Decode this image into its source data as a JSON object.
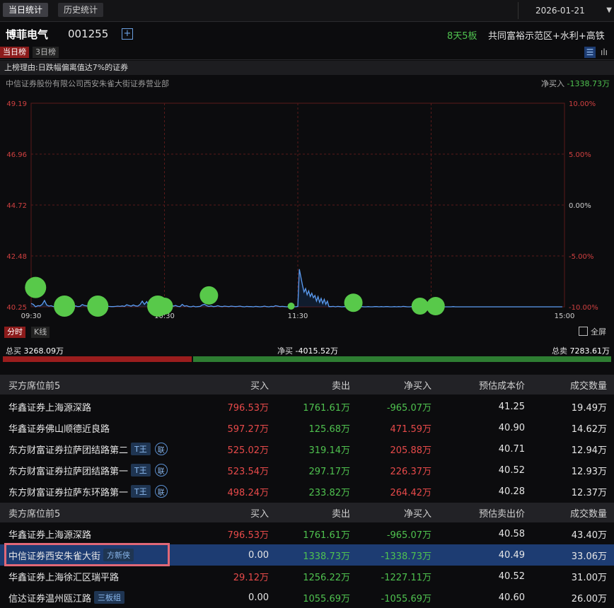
{
  "top_tabs": [
    "当日统计",
    "历史统计"
  ],
  "date": "2026-01-21",
  "stock": {
    "name": "博菲电气",
    "code": "001255",
    "add_icon": "plus-square-icon",
    "board": "8天5板",
    "concept": "共同富裕示范区+水利+高铁"
  },
  "sub_tabs": [
    "当日榜",
    "3日榜"
  ],
  "reason": "上榜理由:日跌幅偏离值达7%的证券",
  "seat": "中信证券股份有限公司西安朱雀大街证券营业部",
  "seat_netbuy_label": "净买入",
  "seat_netbuy_value": "-1338.73万",
  "chart_data": {
    "type": "line",
    "x_start": "09:30",
    "x_end": "15:00",
    "x_ticks": [
      "09:30",
      "10:30",
      "11:30",
      "15:00"
    ],
    "ylim": [
      40.25,
      49.19
    ],
    "y_left_ticks": [
      "49.19",
      "46.96",
      "44.72",
      "42.48",
      "40.25"
    ],
    "y_right_ticks": [
      "10.00%",
      "5.00%",
      "0.00%",
      "-5.00%",
      "-10.00%"
    ],
    "series": [
      {
        "values": [
          40.4,
          40.36,
          40.25,
          40.3,
          40.29,
          40.36,
          40.53,
          40.33,
          40.28,
          40.3,
          40.26,
          40.29,
          40.27,
          40.3,
          40.27,
          40.28,
          40.26,
          40.28,
          40.27,
          40.26,
          40.29,
          40.26,
          40.27,
          40.35,
          40.31,
          40.29,
          40.3,
          40.29,
          40.28,
          40.27,
          40.26,
          40.29,
          40.27,
          40.26,
          40.28,
          40.27,
          40.26,
          40.26,
          40.27,
          40.28,
          40.27,
          40.29,
          40.27,
          40.34,
          40.31,
          40.28,
          40.33,
          40.29,
          40.28,
          40.35,
          40.5,
          40.36,
          40.48,
          40.29,
          40.26,
          40.3,
          40.27,
          40.32,
          40.45,
          40.3,
          40.38,
          40.31,
          40.27,
          40.33,
          40.28,
          40.31,
          40.27,
          40.26,
          40.36,
          40.28,
          40.3,
          40.26,
          40.25,
          40.28,
          40.25,
          40.26,
          40.27,
          40.33,
          40.36,
          40.3,
          40.27,
          40.29,
          40.26,
          40.27,
          40.3,
          40.27,
          40.26,
          40.28,
          40.27,
          40.26,
          40.28,
          40.27,
          40.26,
          40.27,
          40.28,
          40.26,
          40.25,
          40.27,
          40.26,
          40.26,
          40.25,
          40.27,
          40.26,
          40.25,
          40.26,
          40.28,
          40.26,
          40.25,
          40.27,
          40.26,
          40.3,
          40.28,
          40.26,
          40.27,
          40.26,
          40.25,
          40.26,
          40.25,
          40.26,
          40.25,
          40.26,
          40.26,
          40.27,
          40.25,
          40.27,
          40.26,
          40.25,
          40.26,
          40.25,
          40.26,
          40.25,
          40.28,
          40.3,
          40.26,
          40.27,
          40.26,
          40.25,
          40.25,
          40.26,
          40.25,
          40.25,
          40.26,
          40.26,
          40.25,
          40.26,
          40.25,
          40.26,
          40.26,
          40.25,
          40.25,
          40.26,
          40.25,
          40.26,
          40.25,
          40.27,
          40.26,
          40.25,
          40.25,
          40.26,
          40.25,
          40.26,
          40.25,
          40.25,
          40.25,
          40.25,
          40.26,
          40.25,
          40.26,
          40.25,
          40.25,
          40.25,
          40.25,
          40.26,
          40.25,
          40.25,
          40.25,
          40.25,
          40.26,
          40.25,
          40.25,
          40.25,
          40.25,
          40.25,
          40.25,
          40.25,
          40.25,
          40.25,
          40.25,
          40.25,
          40.25,
          40.25,
          40.25,
          40.25,
          40.25,
          40.25,
          40.25,
          40.25,
          40.25,
          40.25,
          40.25,
          40.25,
          40.25,
          40.25,
          40.25,
          40.25,
          40.25,
          40.25,
          40.25,
          40.25,
          40.25,
          40.25,
          40.25,
          40.25,
          40.25,
          40.25,
          40.25,
          40.25,
          40.25,
          40.25,
          40.25,
          40.25,
          40.25,
          40.25,
          40.25,
          40.25,
          40.25,
          40.25,
          40.25
        ]
      }
    ],
    "spike": {
      "from": "11:30",
      "values": [
        40.27,
        41.9,
        41.55,
        41.2,
        40.9,
        41.05,
        40.78,
        40.95,
        40.7,
        40.85,
        40.65,
        40.75,
        40.5,
        40.7,
        40.45,
        40.62,
        40.4,
        40.58,
        40.36,
        40.5
      ]
    },
    "markers": [
      {
        "t": "09:32",
        "v": 41.1,
        "r": 15
      },
      {
        "t": "09:45",
        "v": 40.25,
        "r": 15
      },
      {
        "t": "10:00",
        "v": 40.25,
        "r": 15
      },
      {
        "t": "10:27",
        "v": 40.25,
        "r": 15
      },
      {
        "t": "10:30",
        "v": 40.22,
        "r": 12
      },
      {
        "t": "10:50",
        "v": 40.75,
        "r": 13
      },
      {
        "t": "11:27",
        "v": 40.23,
        "r": 5
      },
      {
        "t": "13:25",
        "v": 40.43,
        "r": 13
      },
      {
        "t": "13:55",
        "v": 40.25,
        "r": 12
      },
      {
        "t": "14:02",
        "v": 40.25,
        "r": 13
      }
    ]
  },
  "chart_controls": {
    "time": "分时",
    "kline": "K线",
    "fullscreen": "全屏"
  },
  "totals": {
    "buy_label": "总买",
    "buy": "3268.09万",
    "net_label": "净买",
    "net": "-4015.52万",
    "sell_label": "总卖",
    "sell": "7283.61万",
    "buy_ratio": 0.31
  },
  "colors": {
    "red": "#e84a4a",
    "green": "#4fc24f",
    "line": "#5b9cf2",
    "marker": "#58c94a"
  },
  "buy_table": {
    "headers": [
      "买方席位前5",
      "买入",
      "卖出",
      "净买入",
      "预估成本价",
      "成交数量"
    ],
    "rows": [
      {
        "name": "华鑫证券上海源深路",
        "tag": "",
        "lian": "",
        "buy": "796.53万",
        "sell": "1761.61万",
        "net": "-965.07万",
        "price": "41.25",
        "vol": "19.49万"
      },
      {
        "name": "华鑫证券佛山顺德近良路",
        "tag": "",
        "lian": "",
        "buy": "597.27万",
        "sell": "125.68万",
        "net": "471.59万",
        "price": "40.90",
        "vol": "14.62万"
      },
      {
        "name": "东方财富证券拉萨团结路第二",
        "tag": "T王",
        "lian": "联",
        "buy": "525.02万",
        "sell": "319.14万",
        "net": "205.88万",
        "price": "40.71",
        "vol": "12.94万"
      },
      {
        "name": "东方财富证券拉萨团结路第一",
        "tag": "T王",
        "lian": "联",
        "buy": "523.54万",
        "sell": "297.17万",
        "net": "226.37万",
        "price": "40.52",
        "vol": "12.93万"
      },
      {
        "name": "东方财富证券拉萨东环路第一",
        "tag": "T王",
        "lian": "联",
        "buy": "498.24万",
        "sell": "233.82万",
        "net": "264.42万",
        "price": "40.28",
        "vol": "12.37万"
      }
    ]
  },
  "sell_table": {
    "headers": [
      "卖方席位前5",
      "买入",
      "卖出",
      "净买入",
      "预估卖出价",
      "成交数量"
    ],
    "rows": [
      {
        "name": "华鑫证券上海源深路",
        "tag": "",
        "buy": "796.53万",
        "sell": "1761.61万",
        "net": "-965.07万",
        "price": "40.58",
        "vol": "43.40万"
      },
      {
        "name": "中信证券西安朱雀大街",
        "tag": "方新侠",
        "buy": "0.00",
        "sell": "1338.73万",
        "net": "-1338.73万",
        "price": "40.49",
        "vol": "33.06万"
      },
      {
        "name": "华鑫证券上海徐汇区瑞平路",
        "tag": "",
        "buy": "29.12万",
        "sell": "1256.22万",
        "net": "-1227.11万",
        "price": "40.52",
        "vol": "31.00万"
      },
      {
        "name": "信达证券温州瓯江路",
        "tag": "三板组",
        "buy": "0.00",
        "sell": "1055.69万",
        "net": "-1055.69万",
        "price": "40.60",
        "vol": "26.00万"
      }
    ]
  }
}
